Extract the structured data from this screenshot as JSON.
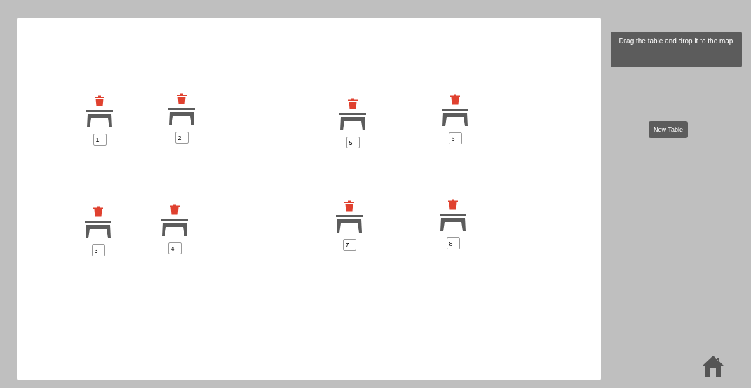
{
  "map": {
    "tables": [
      {
        "number": "1"
      },
      {
        "number": "2"
      },
      {
        "number": "5"
      },
      {
        "number": "6"
      },
      {
        "number": "3"
      },
      {
        "number": "4"
      },
      {
        "number": "7"
      },
      {
        "number": "8"
      }
    ]
  },
  "sidebar": {
    "instructions": "Drag the table and drop it to the map",
    "new_table_button": "New Table"
  }
}
